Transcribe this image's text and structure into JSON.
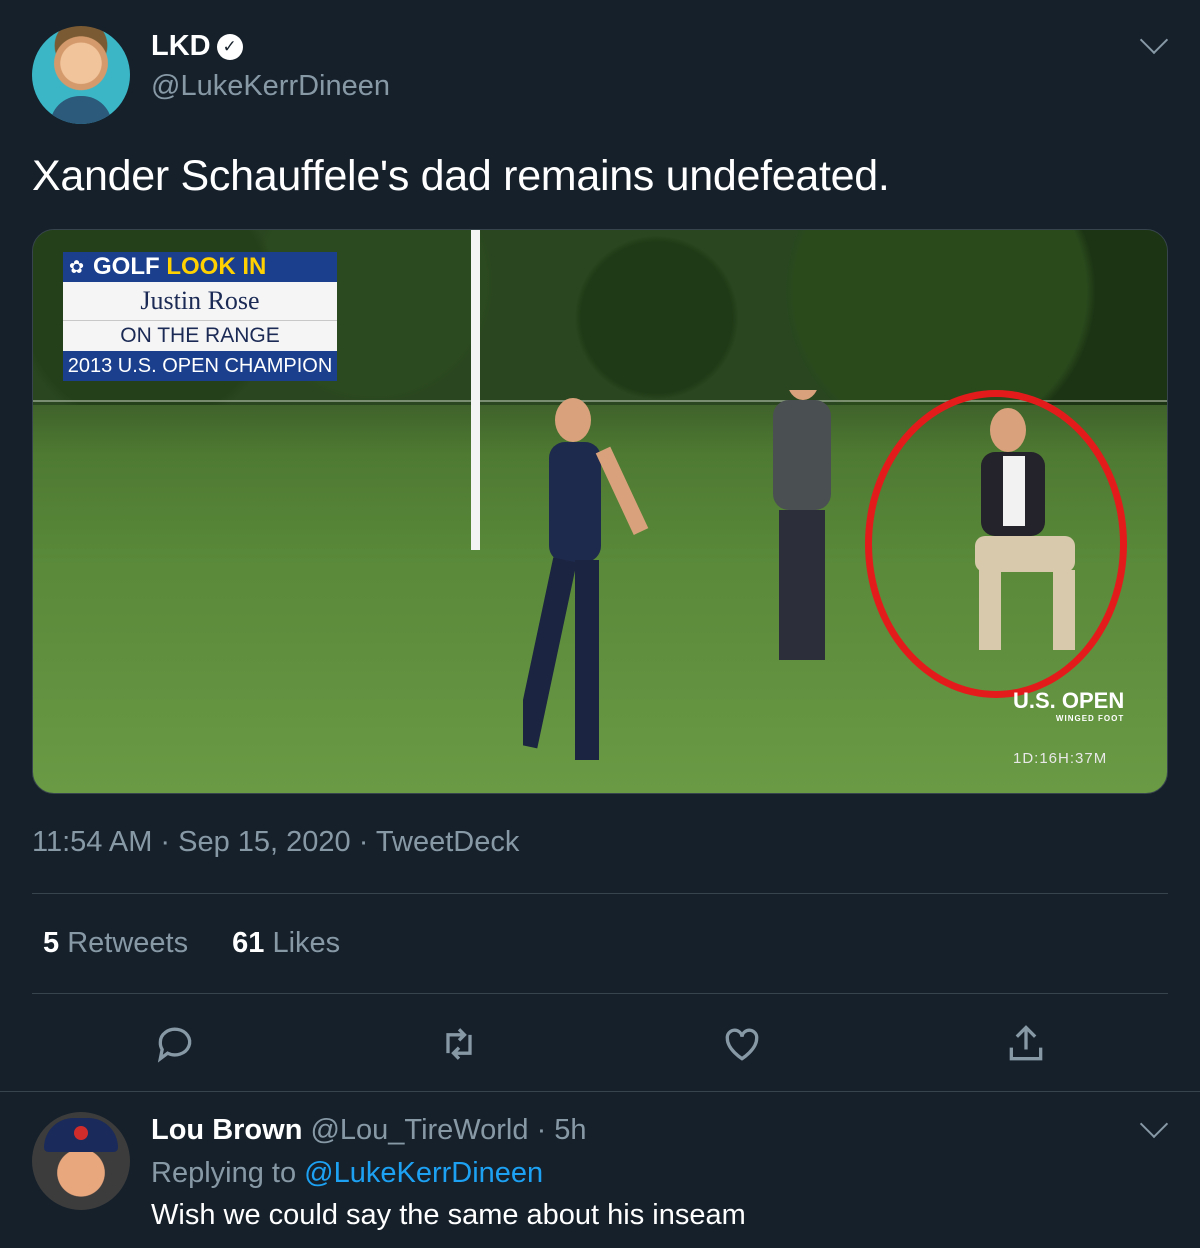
{
  "tweet": {
    "display_name": "LKD",
    "verified_icon": "verified-badge-icon",
    "handle": "@LukeKerrDineen",
    "text": "Xander Schauffele's dad remains undefeated.",
    "media": {
      "lower_third": {
        "brand": "GOLF",
        "brand_accent": "LOOK IN",
        "name": "Justin Rose",
        "subtitle": "ON THE RANGE",
        "caption": "2013 U.S. OPEN CHAMPION"
      },
      "event_logo": "U.S. OPEN",
      "event_sub": "WINGED FOOT",
      "countdown": "1D:16H:37M",
      "highlight_color": "#e31b1b"
    },
    "timestamp": "11:54 AM · Sep 15, 2020 · TweetDeck",
    "stats": {
      "retweets_count": "5",
      "retweets_label": "Retweets",
      "likes_count": "61",
      "likes_label": "Likes"
    },
    "actions": [
      "reply-icon",
      "retweet-icon",
      "like-icon",
      "share-icon"
    ]
  },
  "reply": {
    "name": "Lou Brown",
    "handle": "@Lou_TireWorld",
    "time": "5h",
    "replying_prefix": "Replying to",
    "replying_to": "@LukeKerrDineen",
    "text": "Wish we could say the same about his inseam"
  },
  "colors": {
    "background": "#15202b",
    "muted": "#8899a6",
    "link": "#1da1f2",
    "divider": "#38444d"
  }
}
